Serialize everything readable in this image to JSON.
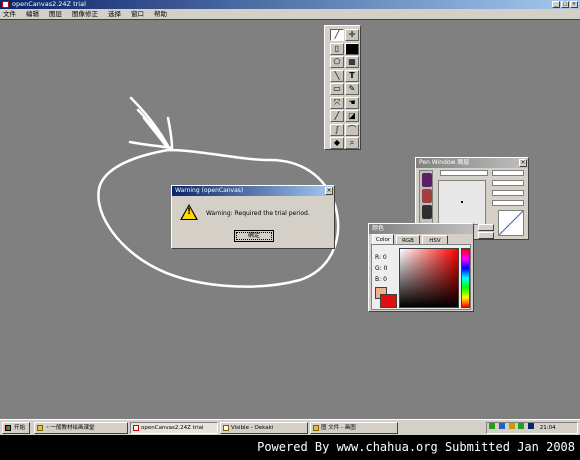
{
  "window": {
    "title": "openCanvas2.24Z trial"
  },
  "menu": [
    "文件",
    "编辑",
    "图层",
    "图像修正",
    "选择",
    "窗口",
    "帮助"
  ],
  "tools": [
    "pen",
    "move",
    "brush",
    "fill-black",
    "select-lasso",
    "dots",
    "line",
    "text",
    "rect",
    "eyedropper",
    "transform",
    "hand",
    "pipette",
    "zoom",
    "curve",
    "curve2",
    "eraser",
    "search"
  ],
  "warning_dialog": {
    "title": "Warning (openCanvas)",
    "message": "Warning:  Required the trial period.",
    "ok_label": "确定"
  },
  "nav_window": {
    "title": "Pen Window 图层"
  },
  "color_window": {
    "title": "颜色",
    "tabs": [
      "Color",
      "RGB",
      "HSV"
    ],
    "labels": [
      "R",
      "G",
      "B"
    ],
    "values": [
      "0",
      "0",
      "0"
    ],
    "current_color": "#e01010",
    "bg_color": "#f0b090"
  },
  "taskbar": {
    "start_label": "开始",
    "tasks": [
      "・一般教材绘画课堂",
      "openCanvas2.24Z trial",
      "Visible - Oekaki",
      "图 文件 - 画图"
    ],
    "clock": "21:04"
  },
  "footer": {
    "text": "Powered By www.chahua.org  Submitted Jan 2008"
  },
  "colors": {
    "desktop": "#808080",
    "titlebar": "#0a246a",
    "chrome": "#d4d0c8",
    "scribble": "#ffffff"
  }
}
